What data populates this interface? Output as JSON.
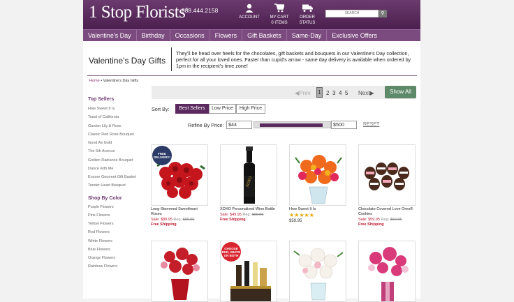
{
  "header": {
    "logo": "1 Stop Florists",
    "logo_mark": "®",
    "phone": "888.444.2158",
    "account": "ACCOUNT",
    "cart_label": "MY CART",
    "cart_items": "0 ITEMS",
    "order": "ORDER",
    "status": "STATUS",
    "search_placeholder": "SEARCH"
  },
  "nav": [
    "Valentine's Day",
    "Birthday",
    "Occasions",
    "Flowers",
    "Gift Baskets",
    "Same-Day",
    "Exclusive Offers"
  ],
  "page_title": "Valentine's Day Gifts",
  "intro": "They'll be head over heels for the chocolates, gift baskets and bouquets in our Valentine's Day collection, perfect for all your loved ones. Faster than cupid's arrow - same day delivery is available when ordered by 1pm in the recipient's time zone!",
  "breadcrumb": {
    "home": "Home",
    "sep": "•",
    "current": "Valentine's Day Gifts"
  },
  "sidebar": {
    "top_sellers_title": "Top Sellers",
    "top_sellers": [
      "How Sweet It Is",
      "Toast of California",
      "Garden Lily & Rose",
      "Classic Red Rose Bouquet",
      "Good As Gold",
      "The 5th Avenue",
      "Golden Radiance Bouquet",
      "Dance with Me",
      "Encore Gourmet Gift Basket",
      "Tender Heart Bouquet"
    ],
    "color_title": "Shop By Color",
    "colors": [
      "Purple Flowers",
      "Pink Flowers",
      "Yellow Flowers",
      "Red Flowers",
      "White Flowers",
      "Blue Flowers",
      "Orange Flowers",
      "Rainbow Flowers"
    ]
  },
  "pager": {
    "prev": "Prev",
    "pages": [
      "1",
      "2",
      "3",
      "4",
      "5"
    ],
    "next": "Next",
    "show_all": "Show All"
  },
  "sort": {
    "label": "Sort By:",
    "options": [
      "Best Sellers",
      "Low Price",
      "High Price"
    ],
    "selected": "Best Sellers"
  },
  "refine": {
    "label": "Refine By Price:",
    "min": "$44",
    "max": "$500",
    "reset": "RESET"
  },
  "products": [
    {
      "name": "Long-Stemmed Sweetheart Roses",
      "sale": "Sale: $89.95",
      "reg_label": "Reg:",
      "reg": "$99.95",
      "ship": "Free Shipping",
      "badge": "FREE DELIVERY!"
    },
    {
      "name": "XOXO Personalized Wine Bottle",
      "sale": "Sale: $49.95",
      "reg_label": "Reg:",
      "reg": "$99.95",
      "ship": "Free Shipping",
      "label_text": "XOXO"
    },
    {
      "name": "How Sweet It Is",
      "rating": 4.5,
      "stars": "★★★★★",
      "price": "$59.95"
    },
    {
      "name": "Chocolate Covered Love Oreo® Cookies",
      "sale": "Sale: $59.95",
      "reg_label": "Reg:",
      "reg": "$69.95",
      "ship": "Free Shipping"
    },
    {
      "name": "",
      "badge": "CHOOSE RED, WHITE OR BOTH"
    },
    {
      "name": ""
    },
    {
      "name": ""
    },
    {
      "name": ""
    }
  ],
  "colors": {
    "brand": "#5b2a5e",
    "sale": "#c0172f",
    "showall": "#5f8a6a"
  }
}
